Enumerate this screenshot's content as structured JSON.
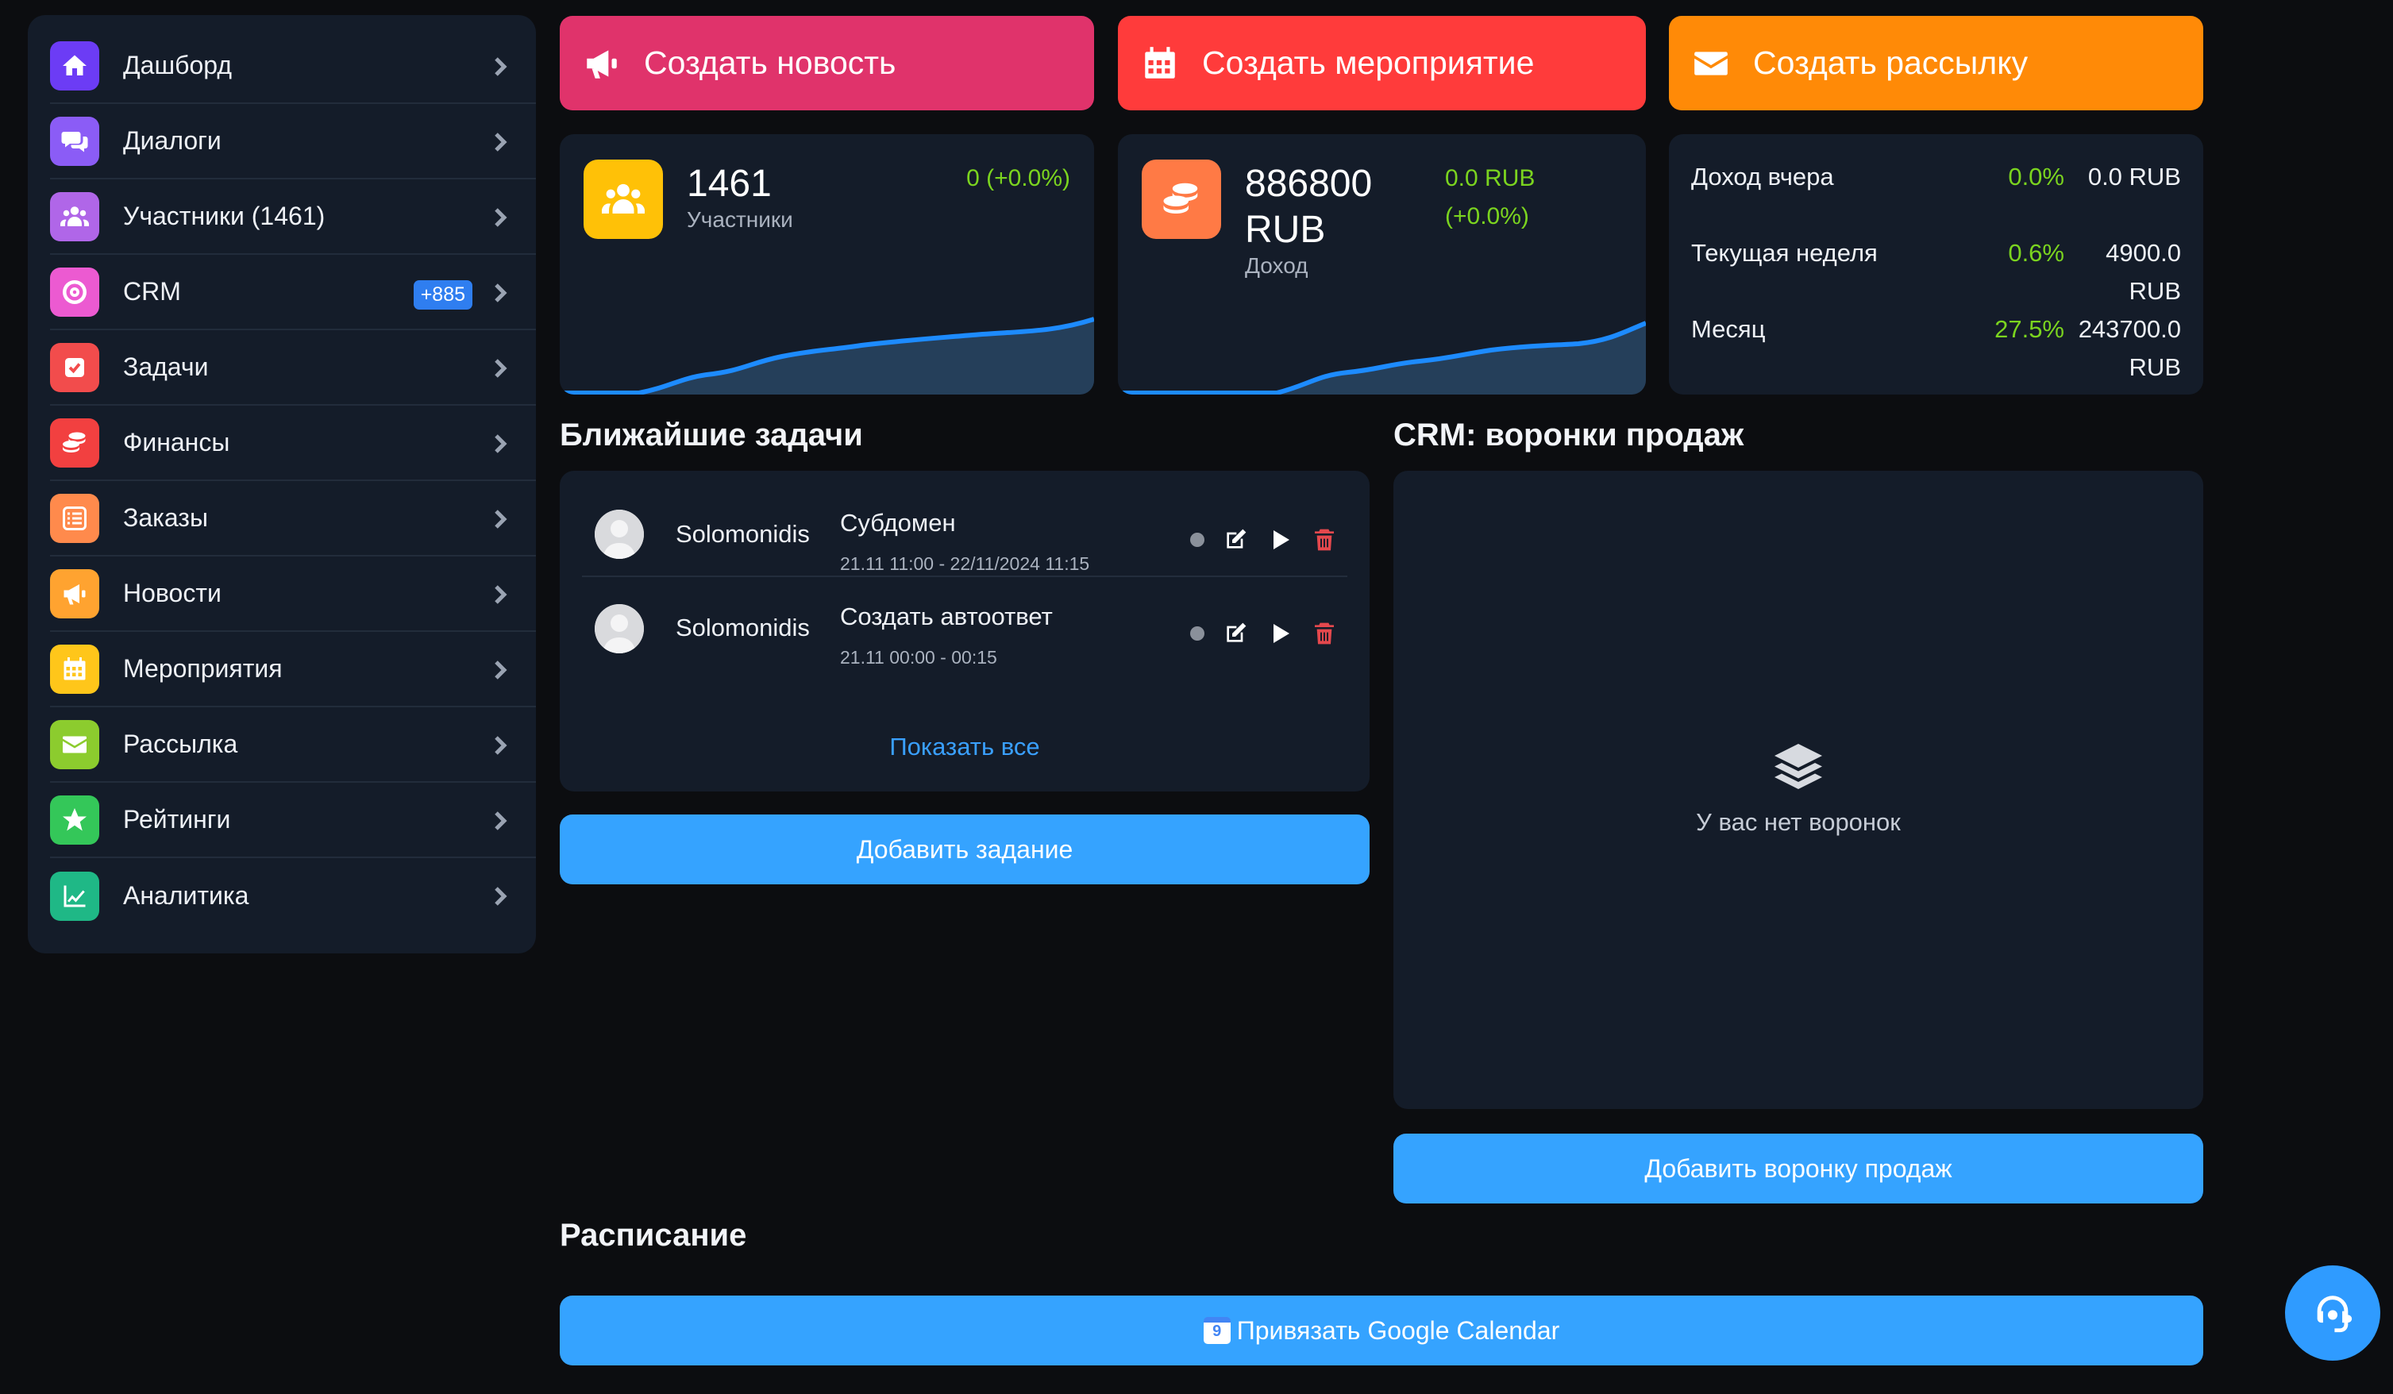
{
  "sidebar": {
    "items": [
      {
        "label": "Дашборд",
        "icon": "home-icon",
        "color": "#6c3cf5"
      },
      {
        "label": "Диалоги",
        "icon": "chat-icon",
        "color": "#8b5cf6"
      },
      {
        "label": "Участники (1461)",
        "icon": "users-icon",
        "color": "#b066e8"
      },
      {
        "label": "CRM",
        "icon": "target-icon",
        "color": "#ec5ad1",
        "badge": "+885"
      },
      {
        "label": "Задачи",
        "icon": "task-check-icon",
        "color": "#f24c4c"
      },
      {
        "label": "Финансы",
        "icon": "coins-icon",
        "color": "#f24040"
      },
      {
        "label": "Заказы",
        "icon": "list-icon",
        "color": "#ff8a4c"
      },
      {
        "label": "Новости",
        "icon": "megaphone-icon",
        "color": "#ffa330"
      },
      {
        "label": "Мероприятия",
        "icon": "calendar-icon",
        "color": "#ffc61a"
      },
      {
        "label": "Рассылка",
        "icon": "envelope-icon",
        "color": "#8ccc2e"
      },
      {
        "label": "Рейтинги",
        "icon": "star-icon",
        "color": "#34c759"
      },
      {
        "label": "Аналитика",
        "icon": "chart-line-icon",
        "color": "#1fb886"
      }
    ]
  },
  "actions": {
    "news": "Создать новость",
    "event": "Создать мероприятие",
    "mail": "Создать рассылку"
  },
  "stats": {
    "members": {
      "value": "1461",
      "caption": "Участники",
      "delta": "0 (+0.0%)",
      "color": "#ffc107"
    },
    "income": {
      "value_line1": "886800",
      "value_line2": "RUB",
      "caption": "Доход",
      "delta_line1": "0.0 RUB",
      "delta_line2": "(+0.0%)",
      "color": "#ff7a45"
    },
    "summary": [
      {
        "label": "Доход вчера",
        "pct": "0.0%",
        "value_line1": "0.0 RUB",
        "value_line2": ""
      },
      {
        "label": "Текущая неделя",
        "pct": "0.6%",
        "value_line1": "4900.0",
        "value_line2": "RUB"
      },
      {
        "label": "Месяц",
        "pct": "27.5%",
        "value_line1": "243700.0",
        "value_line2": "RUB"
      }
    ]
  },
  "tasks": {
    "title": "Ближайшие задачи",
    "items": [
      {
        "user": "Solomonidis",
        "title": "Субдомен",
        "time": "21.11 11:00 - 22/11/2024 11:15"
      },
      {
        "user": "Solomonidis",
        "title": "Создать автоответ",
        "time": "21.11 00:00 - 00:15"
      }
    ],
    "show_all": "Показать все",
    "add_button": "Добавить задание"
  },
  "crm": {
    "title": "CRM: воронки продаж",
    "empty": "У вас нет воронок",
    "add_button": "Добавить воронку продаж"
  },
  "schedule": {
    "title": "Расписание",
    "gcal_button": "Привязать Google Calendar",
    "gcal_icon_text": "9"
  },
  "colors": {
    "accent": "#35a3ff",
    "positive": "#7bd41f",
    "danger": "#e5484d",
    "card": "#141c29",
    "background": "#0c0d10"
  }
}
